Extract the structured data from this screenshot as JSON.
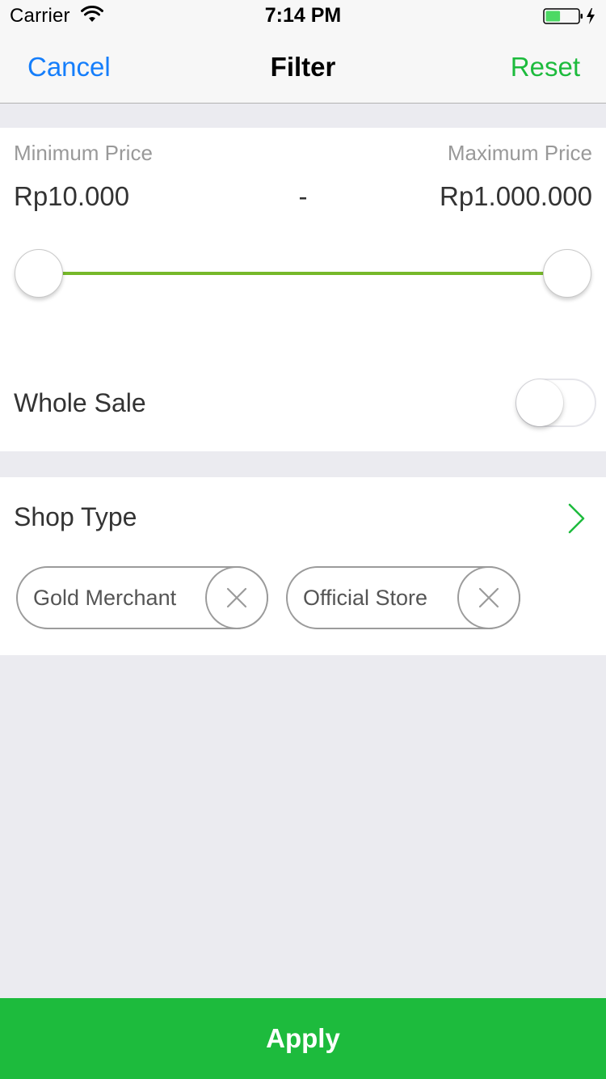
{
  "status_bar": {
    "carrier": "Carrier",
    "time": "7:14 PM",
    "wifi_icon": "wifi-icon",
    "battery_icon": "battery-charging-icon",
    "battery_level": 0.45,
    "battery_color": "#4cd964"
  },
  "nav": {
    "cancel_label": "Cancel",
    "title": "Filter",
    "reset_label": "Reset"
  },
  "price": {
    "min_label": "Minimum Price",
    "max_label": "Maximum Price",
    "min_value": "Rp10.000",
    "separator": "-",
    "max_value": "Rp1.000.000",
    "slider_min_position": 0.0,
    "slider_max_position": 1.0,
    "track_color": "#76b82a"
  },
  "wholesale": {
    "label": "Whole Sale",
    "enabled": false
  },
  "shop_type": {
    "label": "Shop Type",
    "chevron_icon": "chevron-right-icon",
    "chips": [
      {
        "label": "Gold Merchant",
        "remove_icon": "close-icon"
      },
      {
        "label": "Official Store",
        "remove_icon": "close-icon"
      }
    ]
  },
  "apply_label": "Apply",
  "colors": {
    "accent_green": "#1dbb3d",
    "link_blue": "#157efb",
    "background": "#ebebf0"
  }
}
